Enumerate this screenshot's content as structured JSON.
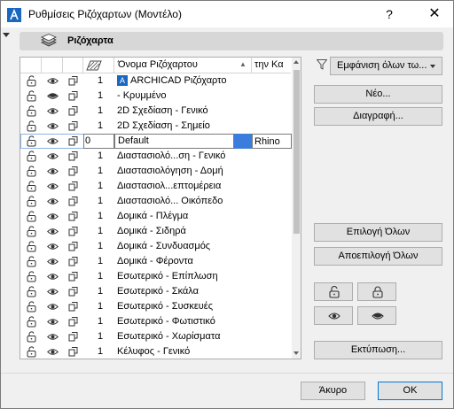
{
  "window": {
    "title": "Ρυθμίσεις Ριζόχαρτων (Μοντέλο)",
    "help_label": "?",
    "close_label": "✕"
  },
  "section": {
    "title": "Ριζόχαρτα"
  },
  "list": {
    "columns": {
      "name": "Όνομα Ριζόχαρτου",
      "cad": "την Κα"
    },
    "rows": [
      {
        "num": "1",
        "name": "ARCHICAD Ριζόχαρτο",
        "hidden": false,
        "archicad_icon": true
      },
      {
        "num": "1",
        "name": "- Κρυμμένο",
        "hidden": true
      },
      {
        "num": "1",
        "name": "2D Σχεδίαση - Γενικό",
        "hidden": false
      },
      {
        "num": "1",
        "name": "2D Σχεδίαση - Σημείο",
        "hidden": false
      },
      {
        "num": "0",
        "name": "Default",
        "hidden": false,
        "selected": true,
        "cad": "Rhino"
      },
      {
        "num": "1",
        "name": "Διαστασιολό...ση - Γενικό",
        "hidden": false
      },
      {
        "num": "1",
        "name": "Διαστασιολόγηση - Δομή",
        "hidden": false
      },
      {
        "num": "1",
        "name": "Διαστασιολ...επτομέρεια",
        "hidden": false
      },
      {
        "num": "1",
        "name": "Διαστασιολό... Οικόπεδο",
        "hidden": false
      },
      {
        "num": "1",
        "name": "Δομικά - Πλέγμα",
        "hidden": false
      },
      {
        "num": "1",
        "name": "Δομικά - Σιδηρά",
        "hidden": false
      },
      {
        "num": "1",
        "name": "Δομικά - Συνδυασμός",
        "hidden": false
      },
      {
        "num": "1",
        "name": "Δομικά - Φέροντα",
        "hidden": false
      },
      {
        "num": "1",
        "name": "Εσωτερικό - Επίπλωση",
        "hidden": false
      },
      {
        "num": "1",
        "name": "Εσωτερικό - Σκάλα",
        "hidden": false
      },
      {
        "num": "1",
        "name": "Εσωτερικό - Συσκευές",
        "hidden": false
      },
      {
        "num": "1",
        "name": "Εσωτερικό - Φωτιστικό",
        "hidden": false
      },
      {
        "num": "1",
        "name": "Εσωτερικό - Χωρίσματα",
        "hidden": false
      },
      {
        "num": "1",
        "name": "Κέλυφος - Γενικό",
        "hidden": false
      }
    ]
  },
  "side": {
    "filter_dropdown": "Εμφάνιση όλων τω...",
    "new_label": "Νέο...",
    "delete_label": "Διαγραφή...",
    "select_all_label": "Επιλογή Όλων",
    "deselect_all_label": "Αποεπιλογή Όλων",
    "print_label": "Εκτύπωση..."
  },
  "footer": {
    "cancel_label": "Άκυρο",
    "ok_label": "OK"
  },
  "colors": {
    "selection_outline": "#8fb2e0",
    "rhino_swatch": "#3b7ddd",
    "ok_border": "#0078d7"
  }
}
